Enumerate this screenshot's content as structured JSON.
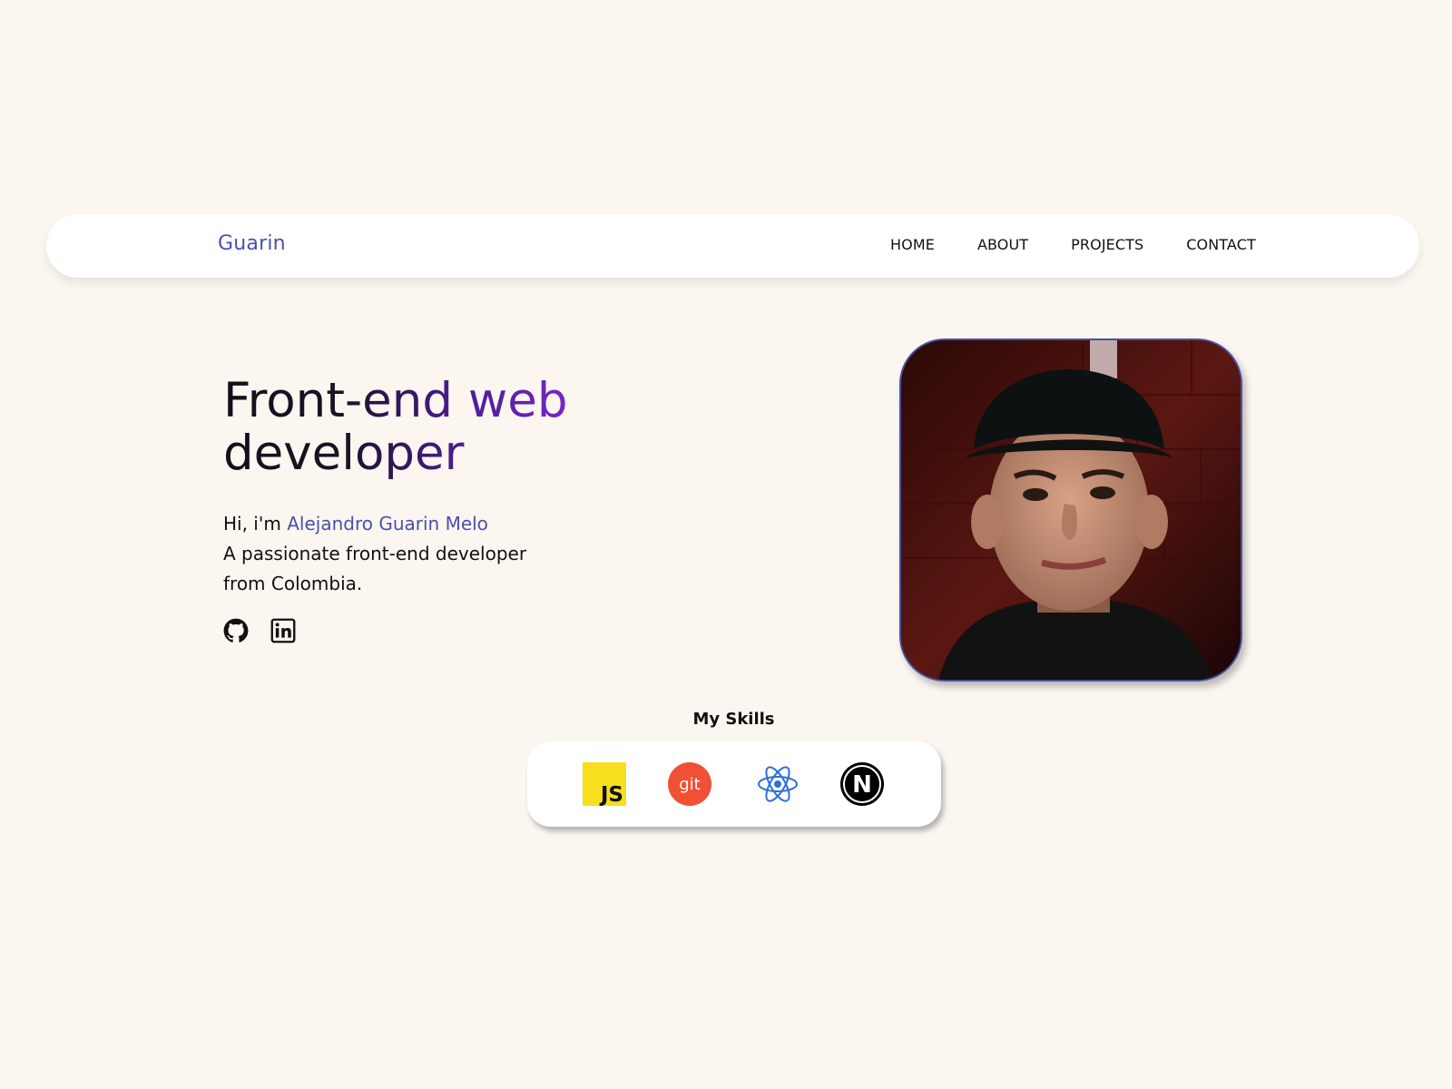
{
  "navbar": {
    "brand": "Guarin",
    "links": [
      {
        "label": "HOME"
      },
      {
        "label": "ABOUT"
      },
      {
        "label": "PROJECTS"
      },
      {
        "label": "CONTACT"
      }
    ]
  },
  "hero": {
    "title": "Front-end web developer",
    "greeting": "Hi, i'm ",
    "name": "Alejandro Guarin Melo",
    "tagline": "A passionate front-end developer from Colombia.",
    "socials": [
      {
        "icon": "github-icon"
      },
      {
        "icon": "linkedin-icon"
      }
    ]
  },
  "avatar": {
    "icon": "profile-photo"
  },
  "skills": {
    "heading": "My Skills",
    "items": [
      {
        "icon": "javascript-icon",
        "label": "JS"
      },
      {
        "icon": "git-icon",
        "label": "git"
      },
      {
        "icon": "react-icon"
      },
      {
        "icon": "nextjs-icon",
        "label": "N"
      }
    ]
  },
  "colors": {
    "background": "#fbf6f0",
    "accent": "#4a4fb0",
    "title_gradient_end": "#8a2be2",
    "js_yellow": "#f7df1e",
    "git_orange": "#f05033",
    "react_blue": "#2f6fd6"
  }
}
